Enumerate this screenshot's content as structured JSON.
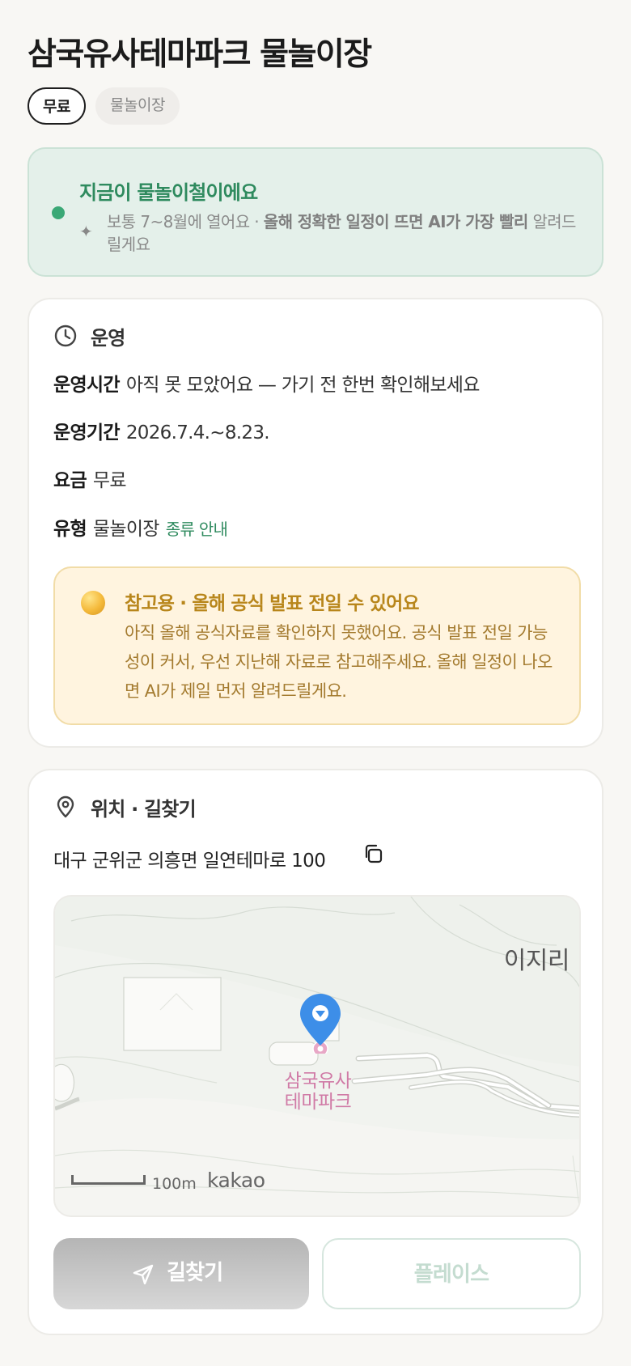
{
  "header": {
    "title": "삼국유사테마파크 물놀이장",
    "chips": [
      "무료",
      "물놀이장"
    ]
  },
  "season_banner": {
    "headline": "지금이 물놀이철이에요",
    "desc_prefix": "보통 7~8월에 열어요 · ",
    "desc_bold": "올해 정확한 일정이 뜨면 AI가 가장 빨리",
    "desc_suffix": " 알려드릴게요",
    "accent": "#3aa876"
  },
  "operation": {
    "title": "운영",
    "rows": [
      {
        "key": "운영시간",
        "value": "아직 못 모았어요 — 가기 전 한번 확인해보세요"
      },
      {
        "key": "운영기간",
        "value": "2026.7.4.~8.23."
      },
      {
        "key": "요금",
        "value": "무료"
      },
      {
        "key": "유형",
        "value": "물놀이장",
        "link": "종류 안내"
      }
    ],
    "notice": {
      "title": "참고용 · 올해 공식 발표 전일 수 있어요",
      "body": "아직 올해 공식자료를 확인하지 못했어요. 공식 발표 전일 가능성이 커서, 우선 지난해 자료로 참고해주세요. 올해 일정이 나오면 AI가 제일 먼저 알려드릴게요."
    }
  },
  "location": {
    "title": "위치 · 길찾기",
    "address": "대구 군위군 의흥면 일연테마로 100",
    "map": {
      "area_label": "이지리",
      "poi_label_line1": "삼국유사",
      "poi_label_line2": "테마파크",
      "scale_label": "100m",
      "provider": "kakao",
      "pin_color": "#3d8ee8"
    },
    "buttons": {
      "route": "길찾기",
      "place": "플레이스"
    }
  },
  "icons": [
    "clock-icon",
    "location-pin-icon",
    "copy-icon",
    "send-arrow-icon",
    "sparkle-icon",
    "coin-icon"
  ]
}
